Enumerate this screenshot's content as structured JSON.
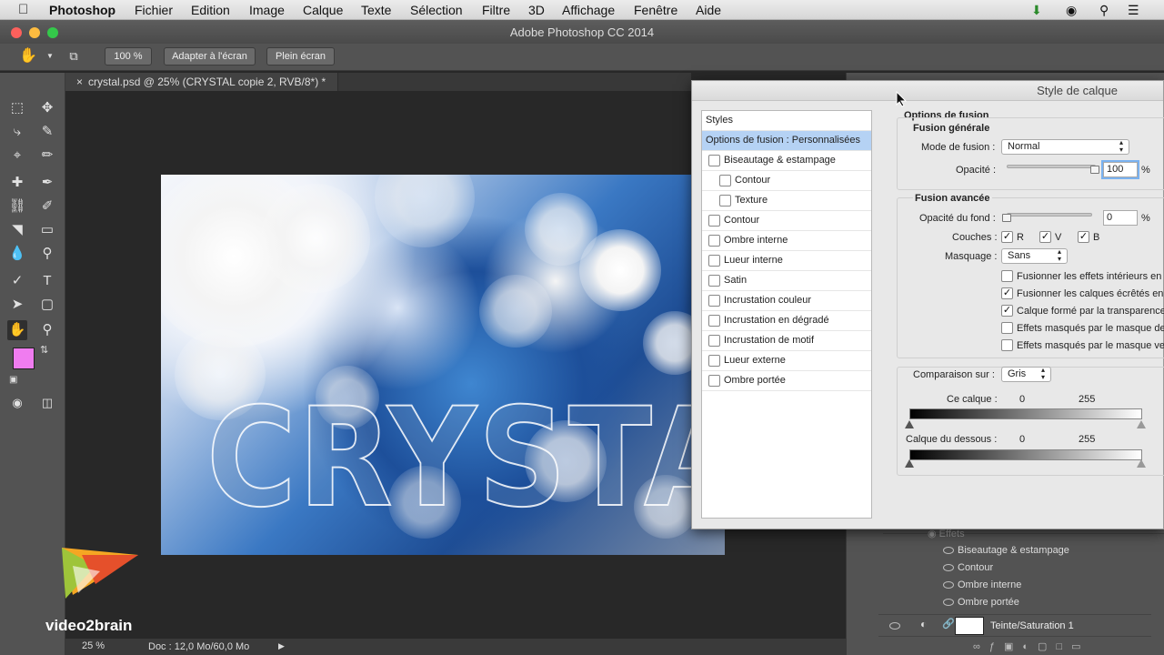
{
  "menubar": {
    "app_name": "Photoshop",
    "items": [
      "Fichier",
      "Edition",
      "Image",
      "Calque",
      "Texte",
      "Sélection",
      "Filtre",
      "3D",
      "Affichage",
      "Fenêtre",
      "Aide"
    ]
  },
  "window": {
    "title": "Adobe Photoshop CC 2014"
  },
  "options_bar": {
    "zoom": "100 %",
    "fit_screen": "Adapter à l'écran",
    "full_screen": "Plein écran"
  },
  "document": {
    "tab_title": "crystal.psd @ 25% (CRYSTAL copie 2, RVB/8*) *",
    "canvas_text": "CRYSTAL"
  },
  "status_bar": {
    "zoom": "25 %",
    "doc_size": "Doc : 12,0 Mo/60,0 Mo"
  },
  "colors": {
    "foreground": "#f07cf0",
    "background": "#ffffff",
    "selection": "#b5d2f4"
  },
  "dialog": {
    "title": "Style de calque",
    "styles_header": "Styles",
    "style_items": [
      {
        "label": "Options de fusion : Personnalisées",
        "selected": true,
        "checkbox": false,
        "indent": false
      },
      {
        "label": "Biseautage & estampage",
        "checked": false,
        "checkbox": true,
        "indent": false
      },
      {
        "label": "Contour",
        "checked": false,
        "checkbox": true,
        "indent": true
      },
      {
        "label": "Texture",
        "checked": false,
        "checkbox": true,
        "indent": true
      },
      {
        "label": "Contour",
        "checked": false,
        "checkbox": true,
        "indent": false
      },
      {
        "label": "Ombre interne",
        "checked": false,
        "checkbox": true,
        "indent": false
      },
      {
        "label": "Lueur interne",
        "checked": false,
        "checkbox": true,
        "indent": false
      },
      {
        "label": "Satin",
        "checked": false,
        "checkbox": true,
        "indent": false
      },
      {
        "label": "Incrustation couleur",
        "checked": false,
        "checkbox": true,
        "indent": false
      },
      {
        "label": "Incrustation en dégradé",
        "checked": false,
        "checkbox": true,
        "indent": false
      },
      {
        "label": "Incrustation de motif",
        "checked": false,
        "checkbox": true,
        "indent": false
      },
      {
        "label": "Lueur externe",
        "checked": false,
        "checkbox": true,
        "indent": false
      },
      {
        "label": "Ombre portée",
        "checked": false,
        "checkbox": true,
        "indent": false
      }
    ],
    "blending_options": {
      "section_title": "Options de fusion",
      "general_title": "Fusion générale",
      "blend_mode_label": "Mode de fusion :",
      "blend_mode_value": "Normal",
      "opacity_label": "Opacité :",
      "opacity_value": "100",
      "opacity_unit": "%",
      "opacity_level": 1.0,
      "advanced_title": "Fusion avancée",
      "fill_opacity_label": "Opacité du fond :",
      "fill_opacity_value": "0",
      "fill_opacity_unit": "%",
      "fill_opacity_level": 0.0,
      "channels_label": "Couches :",
      "channels": [
        {
          "label": "R",
          "checked": true
        },
        {
          "label": "V",
          "checked": true
        },
        {
          "label": "B",
          "checked": true
        }
      ],
      "knockout_label": "Masquage :",
      "knockout_value": "Sans",
      "options": [
        {
          "label": "Fusionner les effets intérieurs en t",
          "checked": false
        },
        {
          "label": "Fusionner les calques écrêtés en t",
          "checked": true
        },
        {
          "label": "Calque formé par la transparence",
          "checked": true
        },
        {
          "label": "Effets masqués par le masque de",
          "checked": false
        },
        {
          "label": "Effets masqués par le masque vec",
          "checked": false
        }
      ],
      "blend_if_label": "Comparaison sur :",
      "blend_if_value": "Gris",
      "this_layer_label": "Ce calque :",
      "this_layer_min": "0",
      "this_layer_max": "255",
      "underlying_label": "Calque du dessous :",
      "underlying_min": "0",
      "underlying_max": "255"
    }
  },
  "layers_panel": {
    "effects_label": "Effets",
    "effects": [
      "Biseautage & estampage",
      "Contour",
      "Ombre interne",
      "Ombre portée"
    ],
    "layer_name": "Teinte/Saturation 1"
  },
  "watermark": {
    "text": "video2brain"
  }
}
